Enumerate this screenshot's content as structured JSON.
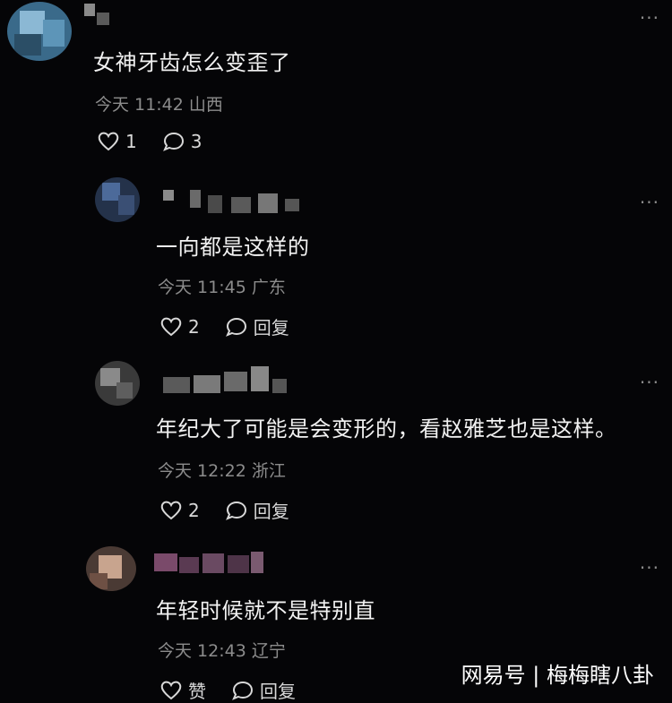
{
  "comments": [
    {
      "text": "女神牙齿怎么变歪了",
      "meta": "今天 11:42 山西",
      "likes": "1",
      "replies": "3",
      "more": "···"
    },
    {
      "text": "一向都是这样的",
      "meta": "今天 11:45 广东",
      "likes": "2",
      "reply_label": "回复",
      "more": "···"
    },
    {
      "text": "年纪大了可能是会变形的，看赵雅芝也是这样。",
      "meta": "今天 12:22 浙江",
      "likes": "2",
      "reply_label": "回复",
      "more": "···"
    },
    {
      "text": "年轻时候就不是特别直",
      "meta": "今天 12:43 辽宁",
      "likes": "赞",
      "reply_label": "回复",
      "more": "···"
    }
  ],
  "watermark": "网易号 | 梅梅瞎八卦",
  "colors": {
    "background": "#050507",
    "meta": "#8c8c8c",
    "text": "#f2f2f2"
  },
  "icons": [
    "heart-outline-icon",
    "comment-bubble-icon",
    "more-dots-icon"
  ]
}
